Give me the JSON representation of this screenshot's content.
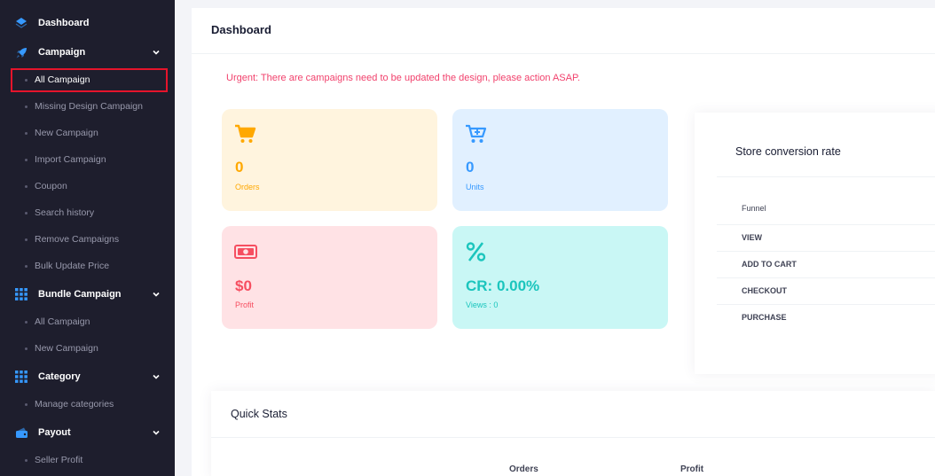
{
  "sidebar": {
    "dashboard": {
      "label": "Dashboard",
      "icon": "layers-icon"
    },
    "campaign": {
      "label": "Campaign",
      "icon": "rocket-icon",
      "items": [
        {
          "label": "All Campaign"
        },
        {
          "label": "Missing Design Campaign"
        },
        {
          "label": "New Campaign"
        },
        {
          "label": "Import Campaign"
        },
        {
          "label": "Coupon"
        },
        {
          "label": "Search history"
        },
        {
          "label": "Remove Campaigns"
        },
        {
          "label": "Bulk Update Price"
        }
      ]
    },
    "bundle": {
      "label": "Bundle Campaign",
      "icon": "grid-icon",
      "items": [
        {
          "label": "All Campaign"
        },
        {
          "label": "New Campaign"
        }
      ]
    },
    "category": {
      "label": "Category",
      "icon": "grid-icon",
      "items": [
        {
          "label": "Manage categories"
        }
      ]
    },
    "payout": {
      "label": "Payout",
      "icon": "wallet-icon",
      "items": [
        {
          "label": "Seller Profit"
        }
      ]
    }
  },
  "header": {
    "title": "Dashboard"
  },
  "alert": {
    "text": "Urgent: There are campaigns need to be updated the design, please action ASAP."
  },
  "stats": {
    "orders": {
      "value": "0",
      "label": "Orders",
      "icon": "cart-icon"
    },
    "units": {
      "value": "0",
      "label": "Units",
      "icon": "cart-plus-icon"
    },
    "profit": {
      "value": "$0",
      "label": "Profit",
      "icon": "banknote-icon"
    },
    "cr": {
      "value": "CR: 0.00%",
      "label": "Views : 0",
      "icon": "percent-icon"
    }
  },
  "conversion": {
    "title": "Store conversion rate",
    "header": "Funnel",
    "rows": [
      {
        "label": "VIEW"
      },
      {
        "label": "ADD TO CART"
      },
      {
        "label": "CHECKOUT"
      },
      {
        "label": "PURCHASE"
      }
    ]
  },
  "quick_stats": {
    "title": "Quick Stats",
    "columns": [
      "Orders",
      "Profit"
    ]
  },
  "colors": {
    "sidebar_bg": "#1e1e2d",
    "accent": "#3699ff",
    "alert": "#f1416c",
    "highlight": "#e5142b"
  }
}
